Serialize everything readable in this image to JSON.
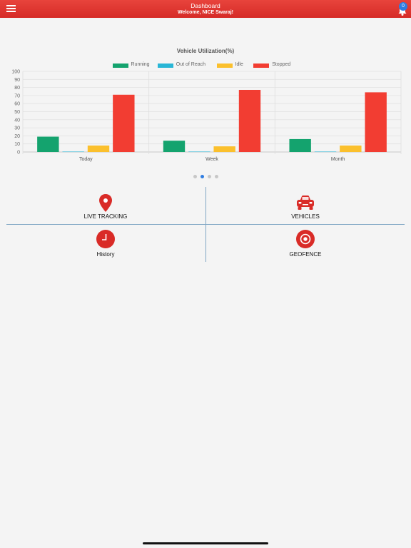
{
  "header": {
    "title": "Dashboard",
    "subtitle": "Welcome, NICE Swaraj!",
    "notification_count": "0"
  },
  "icons": {
    "menu": "hamburger-menu-icon",
    "bell": "bell-icon",
    "live_tracking": "map-pin-icon",
    "vehicles": "car-icon",
    "history": "clock-icon",
    "geofence": "target-icon"
  },
  "colors": {
    "header": "#d62b27",
    "accent": "#2f7de1",
    "icon_red": "#d92b27",
    "running": "#14a36e",
    "out_of_reach": "#29b6d6",
    "idle": "#fbc02d",
    "stopped": "#f23d32"
  },
  "chart_data": {
    "type": "bar",
    "title": "Vehicle Utilization(%)",
    "categories": [
      "Today",
      "Week",
      "Month"
    ],
    "series": [
      {
        "name": "Running",
        "color": "#14a36e",
        "values": [
          19,
          14,
          16
        ]
      },
      {
        "name": "Out of Reach",
        "color": "#29b6d6",
        "values": [
          0.5,
          0.5,
          0.5
        ]
      },
      {
        "name": "Idle",
        "color": "#fbc02d",
        "values": [
          8,
          7,
          8
        ]
      },
      {
        "name": "Stopped",
        "color": "#f23d32",
        "values": [
          71,
          77,
          74
        ]
      }
    ],
    "ylim": [
      0,
      100
    ],
    "yticks": [
      0,
      10,
      20,
      30,
      40,
      50,
      60,
      70,
      80,
      90,
      100
    ],
    "grid": true,
    "legend": "top"
  },
  "pager": {
    "count": 4,
    "active": 1
  },
  "menu": {
    "live_tracking": "LIVE TRACKING",
    "vehicles": "VEHICLES",
    "history": "History",
    "geofence": "GEOFENCE"
  }
}
